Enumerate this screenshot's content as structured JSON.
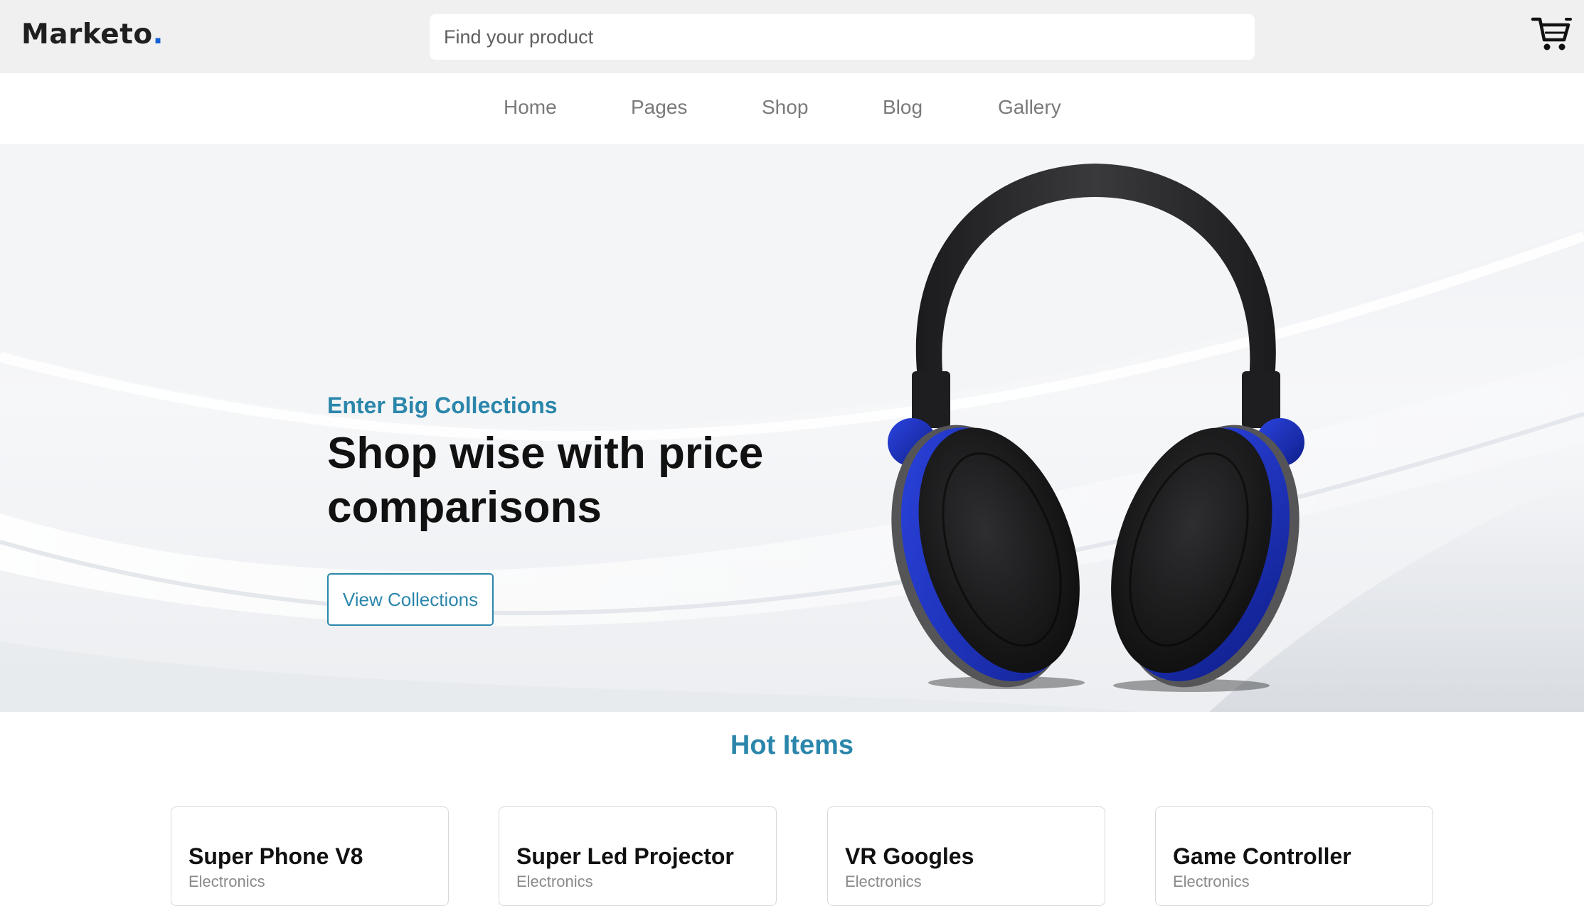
{
  "header": {
    "brand": "Marketo",
    "brand_dot": ".",
    "search_placeholder": "Find your product",
    "cart_icon": "shopping-cart-icon"
  },
  "nav": {
    "items": [
      {
        "label": "Home"
      },
      {
        "label": "Pages"
      },
      {
        "label": "Shop"
      },
      {
        "label": "Blog"
      },
      {
        "label": "Gallery"
      }
    ]
  },
  "hero": {
    "eyebrow": "Enter Big Collections",
    "title": "Shop wise with price comparisons",
    "cta_label": "View Collections",
    "image": "headphones-image"
  },
  "hot_items": {
    "title": "Hot Items",
    "products": [
      {
        "name": "Super Phone V8",
        "category": "Electronics"
      },
      {
        "name": "Super Led Projector",
        "category": "Electronics"
      },
      {
        "name": "VR Googles",
        "category": "Electronics"
      },
      {
        "name": "Game Controller",
        "category": "Electronics"
      }
    ]
  },
  "colors": {
    "accent": "#2b86ab",
    "brand_dot": "#1660d4",
    "topbar_bg": "#f0f0f0",
    "headphone_accent": "#1a2fb8"
  }
}
